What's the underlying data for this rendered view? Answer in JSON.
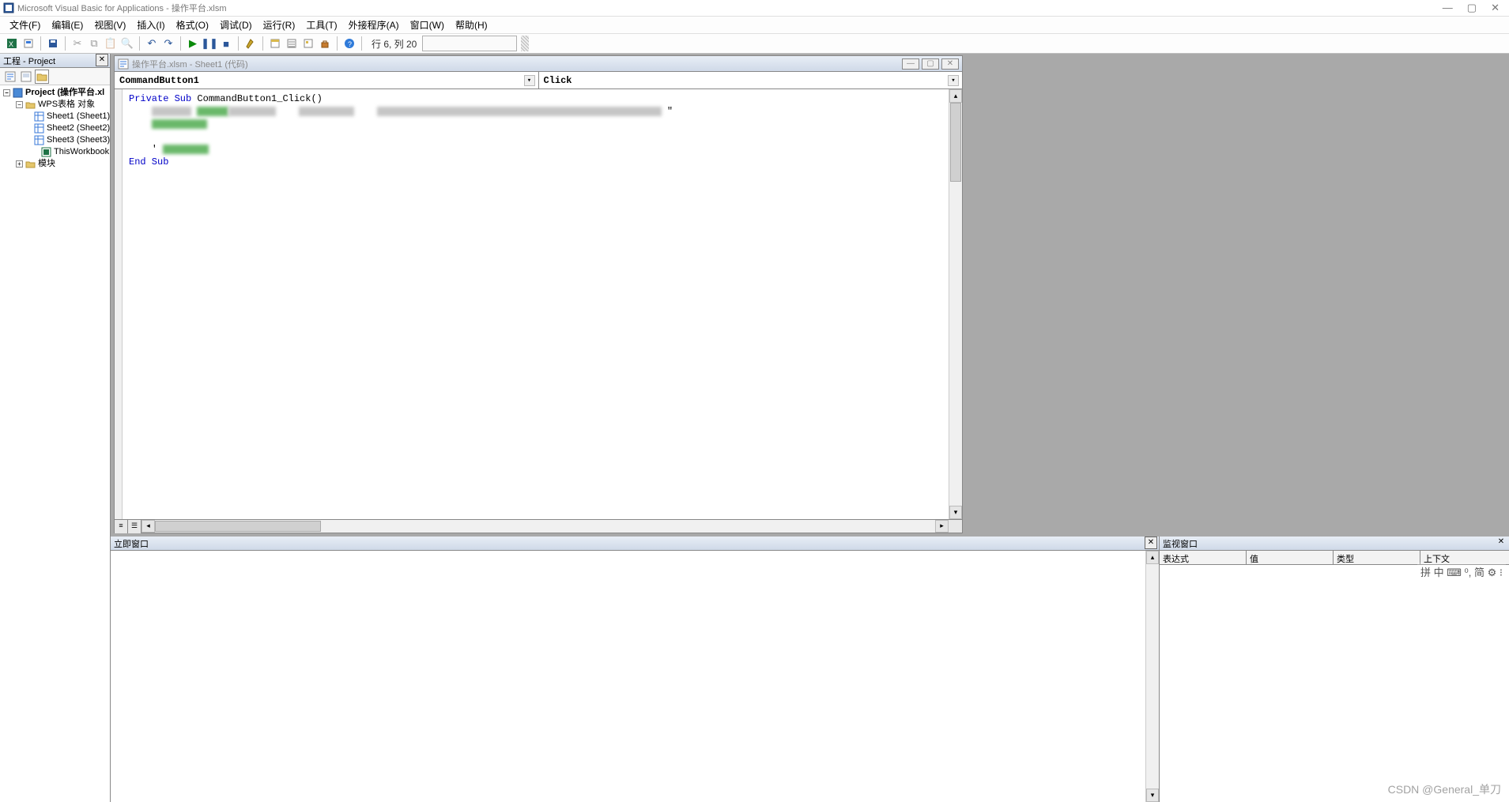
{
  "title_bar": {
    "app_title": "Microsoft Visual Basic for Applications - 操作平台.xlsm"
  },
  "menu": {
    "file": "文件(F)",
    "edit": "编辑(E)",
    "view": "视图(V)",
    "insert": "插入(I)",
    "format": "格式(O)",
    "debug": "调试(D)",
    "run": "运行(R)",
    "tools": "工具(T)",
    "addins": "外接程序(A)",
    "window": "窗口(W)",
    "help": "帮助(H)"
  },
  "toolbar": {
    "status_text": "行 6, 列 20"
  },
  "project_pane": {
    "title": "工程 - Project",
    "root": "Project (操作平台.xl",
    "group": "WPS表格 对象",
    "sheet1": "Sheet1 (Sheet1)",
    "sheet2": "Sheet2 (Sheet2)",
    "sheet3": "Sheet3 (Sheet3)",
    "thiswb": "ThisWorkbook",
    "modules": "模块"
  },
  "code_window": {
    "title": "操作平台.xlsm - Sheet1 (代码)",
    "object_combo": "CommandButton1",
    "proc_combo": "Click",
    "line1_a": "Private Sub",
    "line1_b": " CommandButton1_Click()",
    "line_end": "End Sub"
  },
  "immediate_pane": {
    "title": "立即窗口"
  },
  "watch_pane": {
    "title": "监视窗口",
    "col_expr": "表达式",
    "col_val": "值",
    "col_type": "类型",
    "col_ctx": "上下文"
  },
  "ime_bar": {
    "text": "拼 中 ⌨ ⁰, 简 ⚙ ⁝"
  },
  "watermark": {
    "text": "CSDN @General_单刀"
  }
}
